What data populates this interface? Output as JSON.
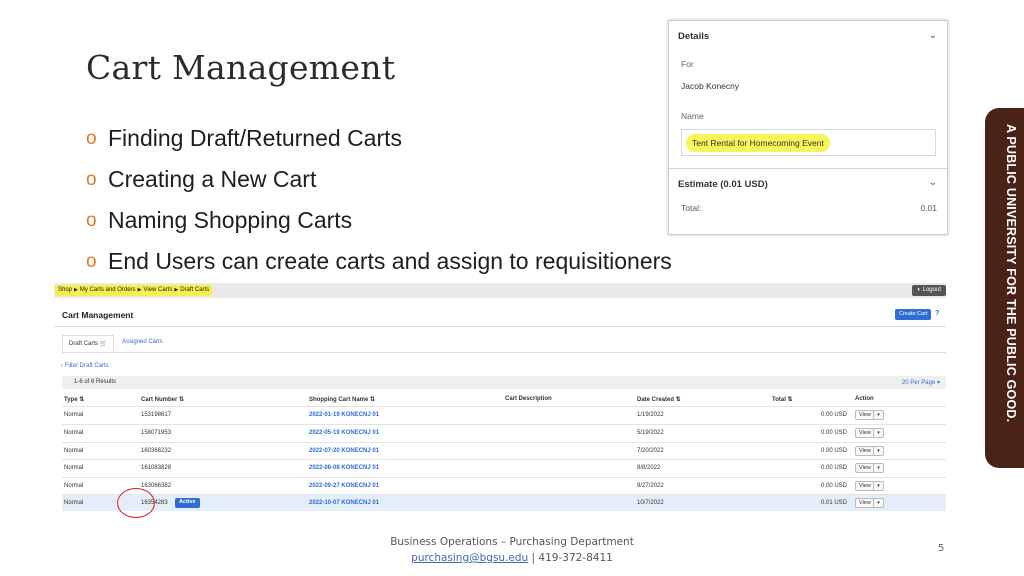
{
  "slide": {
    "title": "Cart Management",
    "bullets": [
      "Finding Draft/Returned Carts",
      "Creating a New Cart",
      "Naming Shopping Carts",
      "End Users can create carts and assign to requisitioners"
    ],
    "banner": "A PUBLIC UNIVERSITY FOR THE PUBLIC GOOD.",
    "footer_line1": "Business Operations – Purchasing Department",
    "footer_email": "purchasing@bgsu.edu",
    "footer_phone": " | 419-372-8411",
    "page_number": "5"
  },
  "details": {
    "header": "Details",
    "for_label": "For",
    "for_value": "Jacob Konecny",
    "name_label": "Name",
    "name_value": "Tent Rental for Homecoming Event",
    "estimate_header": "Estimate (0.01 USD)",
    "total_label": "Total:",
    "total_value": "0.01"
  },
  "app": {
    "breadcrumb": [
      "Shop",
      "My Carts and Orders",
      "View Carts",
      "Draft Carts"
    ],
    "logout_label": "◐ Logout",
    "title": "Cart Management",
    "create_button": "Create Cart",
    "help": "?",
    "tabs": [
      "Draft Carts 🛒",
      "Assigned Carts"
    ],
    "filter_link": "› Filter Draft Carts",
    "results_count": "1-6 of 6 Results",
    "per_page": "20 Per Page ▾",
    "columns": [
      "Type ⇅",
      "Cart Number ⇅",
      "Shopping Cart Name ⇅",
      "Cart Description",
      "Date Created ⇅",
      "Total ⇅",
      "Action"
    ],
    "rows": [
      {
        "type": "Normal",
        "number": "153198617",
        "name": "2022-01-19 KONECNJ 01",
        "date": "1/19/2022",
        "total": "0.00 USD"
      },
      {
        "type": "Normal",
        "number": "158071953",
        "name": "2022-05-19 KONECNJ 01",
        "date": "5/19/2022",
        "total": "0.00 USD"
      },
      {
        "type": "Normal",
        "number": "160366232",
        "name": "2022-07-20 KONECNJ 01",
        "date": "7/20/2022",
        "total": "0.00 USD"
      },
      {
        "type": "Normal",
        "number": "161083828",
        "name": "2022-08-08 KONECNJ 01",
        "date": "8/8/2022",
        "total": "0.00 USD"
      },
      {
        "type": "Normal",
        "number": "163066382",
        "name": "2022-09-27 KONECNJ 01",
        "date": "9/27/2022",
        "total": "0.00 USD"
      },
      {
        "type": "Normal",
        "number": "16354283",
        "name": "2022-10-07 KONECNJ 01",
        "date": "10/7/2022",
        "total": "0.01 USD"
      }
    ],
    "active_badge": "Active",
    "view_label": "View",
    "dropdown_glyph": "▾"
  }
}
